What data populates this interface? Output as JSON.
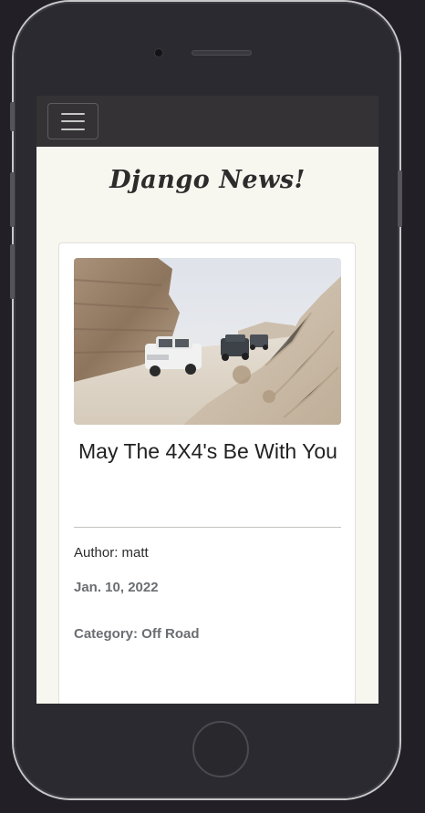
{
  "navbar": {
    "toggler_icon": "hamburger-menu-icon"
  },
  "site": {
    "title": "Django News!"
  },
  "post": {
    "image_icon": "off-road-convoy-photo",
    "title": "May The 4X4's Be With You",
    "author_line": "Author: matt",
    "date": "Jan. 10, 2022",
    "category_line": "Category: Off Road"
  },
  "colors": {
    "screen_background": "#f7f6ef",
    "navbar_background": "#343234",
    "card_background": "#ffffff",
    "muted_text": "#6b6e72"
  }
}
